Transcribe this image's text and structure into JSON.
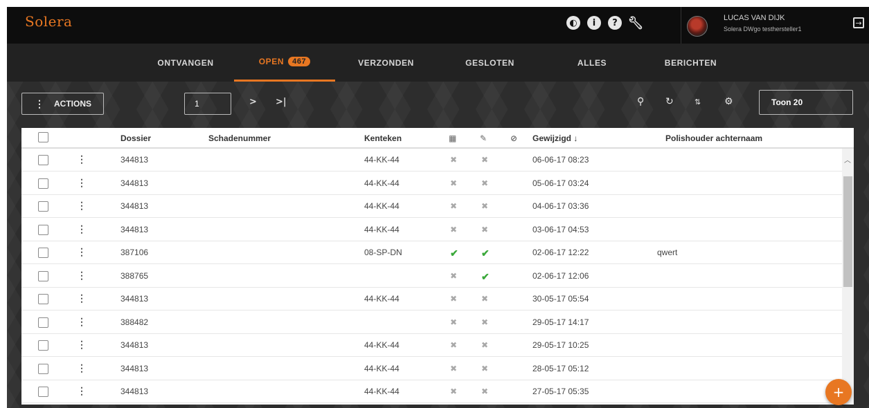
{
  "header": {
    "logo": "Solera",
    "user_name": "LUCAS VAN DIJK",
    "user_sub": "Solera DWgo testhersteller1",
    "icons": [
      "contrast-icon",
      "info-icon",
      "help-icon",
      "wrench-icon",
      "logout-icon"
    ]
  },
  "tabs": [
    {
      "label": "ONTVANGEN",
      "active": false
    },
    {
      "label": "OPEN",
      "badge": "467",
      "active": true
    },
    {
      "label": "VERZONDEN",
      "active": false
    },
    {
      "label": "GESLOTEN",
      "active": false
    },
    {
      "label": "ALLES",
      "active": false
    },
    {
      "label": "BERICHTEN",
      "active": false
    }
  ],
  "toolbar": {
    "actions_label": "ACTIONS",
    "page_value": "1",
    "next_label": ">",
    "last_label": ">|",
    "toon_label": "Toon 20"
  },
  "table": {
    "headers": {
      "dossier": "Dossier",
      "schadenummer": "Schadenummer",
      "kenteken": "Kenteken",
      "gewijzigd": "Gewijzigd ↓",
      "polishouder": "Polishouder achternaam"
    },
    "rows": [
      {
        "dossier": "344813",
        "schadenummer": "",
        "kenteken": "44-KK-44",
        "calc": false,
        "attach": false,
        "gewijzigd": "06-06-17 08:23",
        "polishouder": ""
      },
      {
        "dossier": "344813",
        "schadenummer": "",
        "kenteken": "44-KK-44",
        "calc": false,
        "attach": false,
        "gewijzigd": "05-06-17 03:24",
        "polishouder": ""
      },
      {
        "dossier": "344813",
        "schadenummer": "",
        "kenteken": "44-KK-44",
        "calc": false,
        "attach": false,
        "gewijzigd": "04-06-17 03:36",
        "polishouder": ""
      },
      {
        "dossier": "344813",
        "schadenummer": "",
        "kenteken": "44-KK-44",
        "calc": false,
        "attach": false,
        "gewijzigd": "03-06-17 04:53",
        "polishouder": ""
      },
      {
        "dossier": "387106",
        "schadenummer": "",
        "kenteken": "08-SP-DN",
        "calc": true,
        "attach": true,
        "gewijzigd": "02-06-17 12:22",
        "polishouder": "qwert"
      },
      {
        "dossier": "388765",
        "schadenummer": "",
        "kenteken": "",
        "calc": false,
        "attach": true,
        "gewijzigd": "02-06-17 12:06",
        "polishouder": ""
      },
      {
        "dossier": "344813",
        "schadenummer": "",
        "kenteken": "44-KK-44",
        "calc": false,
        "attach": false,
        "gewijzigd": "30-05-17 05:54",
        "polishouder": ""
      },
      {
        "dossier": "388482",
        "schadenummer": "",
        "kenteken": "",
        "calc": false,
        "attach": false,
        "gewijzigd": "29-05-17 14:17",
        "polishouder": ""
      },
      {
        "dossier": "344813",
        "schadenummer": "",
        "kenteken": "44-KK-44",
        "calc": false,
        "attach": false,
        "gewijzigd": "29-05-17 10:25",
        "polishouder": ""
      },
      {
        "dossier": "344813",
        "schadenummer": "",
        "kenteken": "44-KK-44",
        "calc": false,
        "attach": false,
        "gewijzigd": "28-05-17 05:12",
        "polishouder": ""
      },
      {
        "dossier": "344813",
        "schadenummer": "",
        "kenteken": "44-KK-44",
        "calc": false,
        "attach": false,
        "gewijzigd": "27-05-17 05:35",
        "polishouder": ""
      }
    ]
  },
  "fab_label": "+",
  "colors": {
    "accent": "#e87722",
    "ok": "#3aa83a",
    "topbar": "#0d0d0d"
  }
}
